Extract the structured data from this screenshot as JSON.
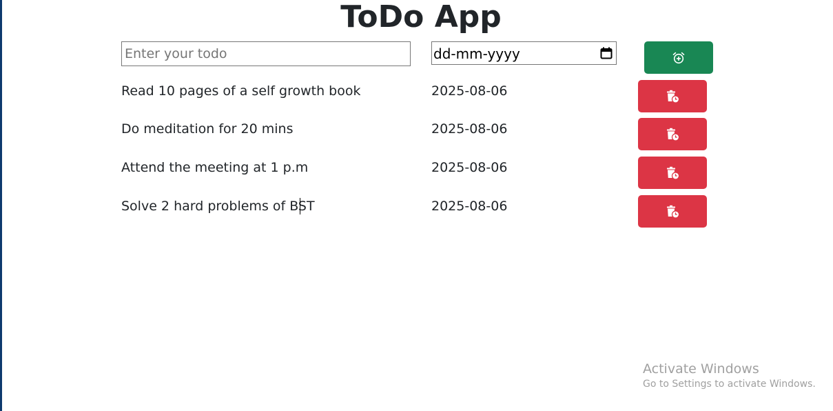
{
  "app": {
    "title": "ToDo App"
  },
  "form": {
    "todo_placeholder": "Enter your todo",
    "todo_value": "",
    "date_placeholder": "dd-mm-yyyy",
    "add_icon": "alarm-plus-icon",
    "add_button_color": "#198754"
  },
  "todos": [
    {
      "name": "Read 10 pages of a self growth book",
      "date": "2025-08-06"
    },
    {
      "name": "Do meditation for 20 mins",
      "date": "2025-08-06"
    },
    {
      "name": "Attend the meeting at 1 p.m",
      "date": "2025-08-06"
    },
    {
      "name": "Solve 2 hard problems of BST",
      "date": "2025-08-06"
    }
  ],
  "delete_button": {
    "icon": "delete-reminder-icon",
    "color": "#dc3545"
  },
  "watermark": {
    "title": "Activate Windows",
    "subtitle": "Go to Settings to activate Windows."
  }
}
